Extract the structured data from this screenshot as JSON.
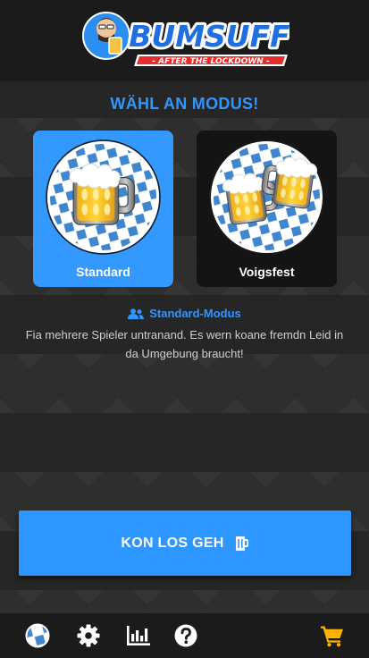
{
  "header": {
    "logo_title": "BUMSUFF!",
    "logo_subtitle": "- AFTER THE LOCKDOWN -"
  },
  "mode_select": {
    "title": "WÄHL AN MODUS!",
    "modes": [
      {
        "label": "Standard",
        "selected": true,
        "icon": "beer-mug-icon"
      },
      {
        "label": "Voigsfest",
        "selected": false,
        "icon": "two-beer-mugs-icon"
      }
    ]
  },
  "mode_info": {
    "icon": "users-icon",
    "heading": "Standard-Modus",
    "description": "Fia mehrere Spieler untranand. Es wern koane fremdn Leid in da Umgebung braucht!"
  },
  "start_button": {
    "label": "KON LOS GEH",
    "icon": "beer-mug-icon"
  },
  "bottom_nav": {
    "items": [
      {
        "name": "bavaria-flag-icon"
      },
      {
        "name": "gear-icon"
      },
      {
        "name": "stats-icon"
      },
      {
        "name": "help-icon"
      },
      {
        "name": "cart-icon"
      }
    ]
  },
  "colors": {
    "accent": "#2e96ff",
    "card_selected": "#3399ff",
    "card_unselected": "#141414",
    "background": "#262626",
    "cart": "#ffb300"
  }
}
